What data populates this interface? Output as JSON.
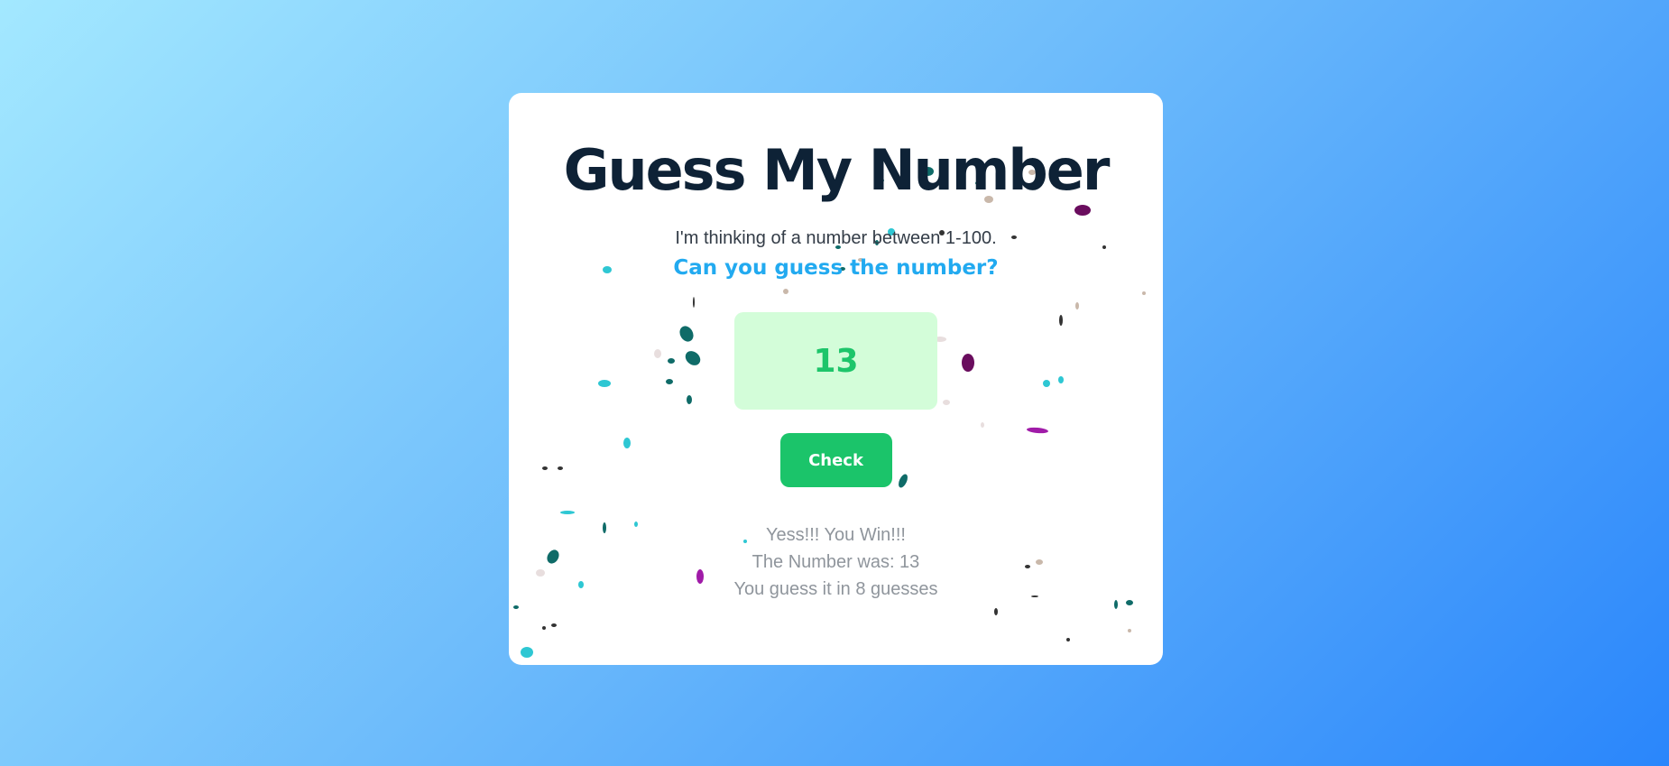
{
  "game": {
    "title": "Guess My Number",
    "subtitle": "I'm thinking of a number between 1-100.",
    "question": "Can you guess the number?",
    "guess_value": "13",
    "check_label": "Check",
    "result": {
      "line1": "Yess!!! You Win!!!",
      "line2": "The Number was: 13",
      "line3": "You guess it in 8 guesses"
    }
  },
  "colors": {
    "title": "#0e2236",
    "accent": "#22aaf0",
    "success": "#1bc46a",
    "guess_bg": "#d3fdd9",
    "confetti": [
      "#0f6b68",
      "#2ec7d3",
      "#6a0d5e",
      "#a01ba8",
      "#c9b8aa",
      "#333333"
    ]
  }
}
